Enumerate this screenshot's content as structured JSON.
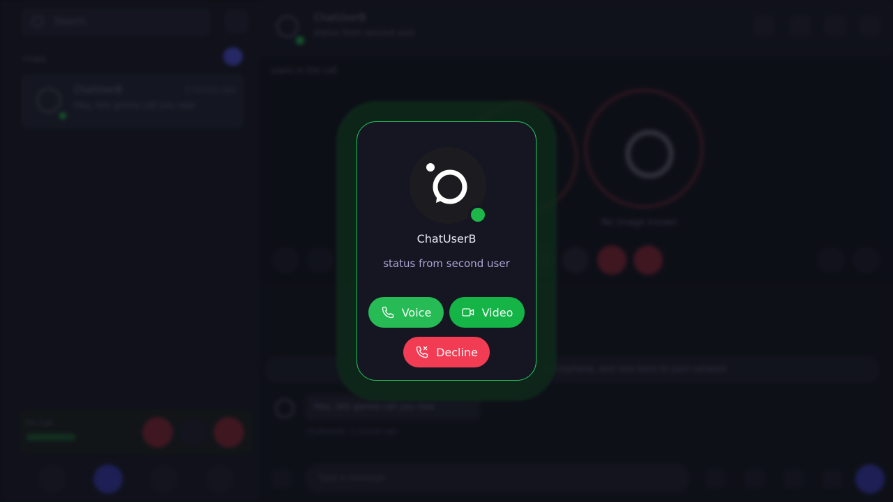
{
  "background": {
    "search_placeholder": "Search",
    "chats_label": "Chats",
    "chat_item": {
      "name": "ChatUserB",
      "time": "1 minute ago",
      "message": "Hey, lets gonna call you now"
    },
    "call_mini_label": "On Call",
    "header": {
      "name": "ChatUserB",
      "status": "status from second user"
    },
    "in_call_label": "users in the call",
    "no_image_label": "No image known",
    "banner_text": "microphone, and now back to your network",
    "message": {
      "text": "Hey, lets gonna call you now",
      "meta": "ChatUserB · 1 minute ago"
    },
    "composer_placeholder": "Type a message"
  },
  "incoming_call": {
    "caller_name": "ChatUserB",
    "caller_status": "status from second user",
    "online": true,
    "voice_label": "Voice",
    "video_label": "Video",
    "decline_label": "Decline",
    "colors": {
      "accent_border": "#22c55e",
      "voice": "#27bb55",
      "video": "#14b447",
      "decline": "#f23c54",
      "online": "#1db649"
    },
    "icons": {
      "voice": "phone-icon",
      "video": "video-camera-icon",
      "decline": "phone-missed-icon"
    }
  }
}
